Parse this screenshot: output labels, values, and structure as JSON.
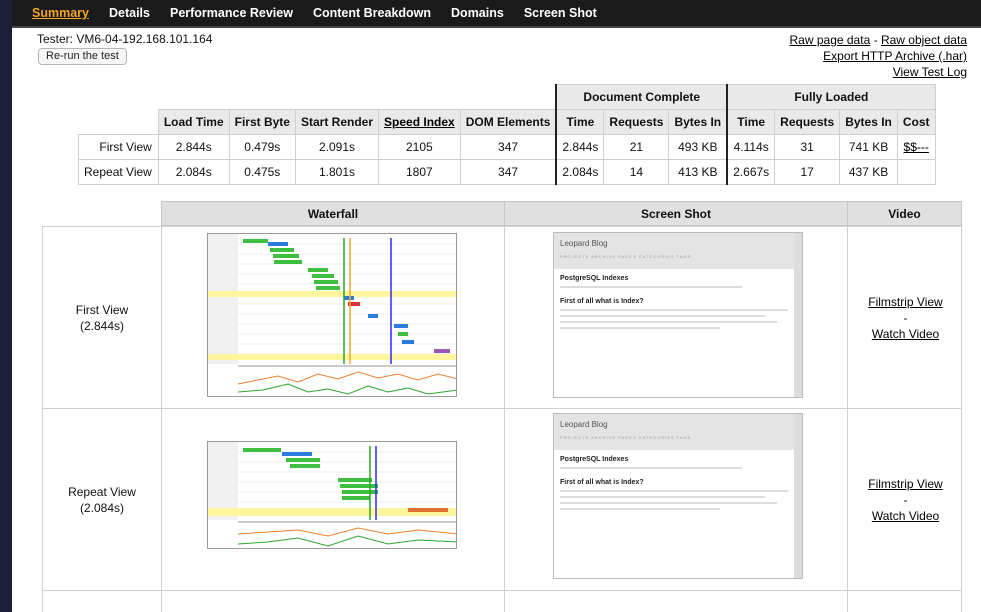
{
  "nav": {
    "items": [
      "Summary",
      "Details",
      "Performance Review",
      "Content Breakdown",
      "Domains",
      "Screen Shot"
    ],
    "active": "Summary"
  },
  "header": {
    "tester": "Tester: VM6-04-192.168.101.164",
    "rerun_label": "Re-run the test",
    "raw_page_data": "Raw page data",
    "separator": "-",
    "raw_object_data": "Raw object data",
    "export_har": "Export HTTP Archive (.har)",
    "view_test_log": "View Test Log"
  },
  "metrics": {
    "group_headers": {
      "document_complete": "Document Complete",
      "fully_loaded": "Fully Loaded"
    },
    "columns": [
      "Load Time",
      "First Byte",
      "Start Render",
      "Speed Index",
      "DOM Elements",
      "Time",
      "Requests",
      "Bytes In",
      "Time",
      "Requests",
      "Bytes In",
      "Cost"
    ],
    "rows": [
      {
        "label": "First View",
        "values": [
          "2.844s",
          "0.479s",
          "2.091s",
          "2105",
          "347",
          "2.844s",
          "21",
          "493 KB",
          "4.114s",
          "31",
          "741 KB",
          "$$---"
        ]
      },
      {
        "label": "Repeat View",
        "values": [
          "2.084s",
          "0.475s",
          "1.801s",
          "1807",
          "347",
          "2.084s",
          "14",
          "413 KB",
          "2.667s",
          "17",
          "437 KB",
          ""
        ]
      }
    ]
  },
  "lower": {
    "headers": {
      "waterfall": "Waterfall",
      "screenshot": "Screen Shot",
      "video": "Video"
    },
    "rows": [
      {
        "view": "First View",
        "time": "(2.844s)",
        "filmstrip": "Filmstrip View",
        "dash": "-",
        "watch": "Watch Video"
      },
      {
        "view": "Repeat View",
        "time": "(2.084s)",
        "filmstrip": "Filmstrip View",
        "dash": "-",
        "watch": "Watch Video"
      }
    ]
  },
  "screenshot": {
    "blog_title": "Leopard Blog",
    "nav_text": "PROJECTS  ARCHIVE  PAGES  CATEGORIES  TAGS",
    "post_title": "PostgreSQL Indexes",
    "subtitle": "First of all what is Index?"
  },
  "colors": {
    "accent": "#f5a623",
    "nav_bg": "#1a1a1a",
    "header_bg": "#e9e9e9"
  }
}
